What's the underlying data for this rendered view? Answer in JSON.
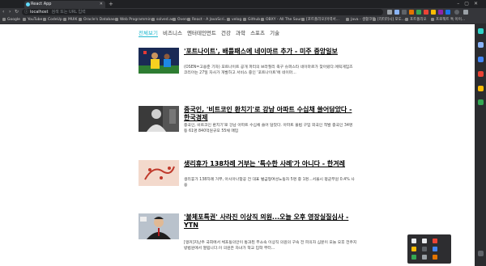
{
  "browser": {
    "tab_title": "React App",
    "url": "localhost",
    "url_hint": "검색 또는 URL 입력",
    "bookmarks": [
      "Google",
      "YouTube",
      "CodeUp",
      "MUIK",
      "Oracle's Database",
      "Web Programming",
      "solved.ac",
      "Oven",
      "React - A JavaScri...",
      "velog",
      "Github",
      "OBXY - All The Sour...",
      "[포트폴리오]이력서...",
      "Java - 생활코딩",
      "[리터러시] 포도...",
      "포트폴리오",
      "프로젝트 톡 이이..."
    ]
  },
  "categories": [
    {
      "label": "전체보기",
      "active": true
    },
    {
      "label": "비즈니스",
      "active": false
    },
    {
      "label": "엔터테인먼트",
      "active": false
    },
    {
      "label": "건강",
      "active": false
    },
    {
      "label": "과학",
      "active": false
    },
    {
      "label": "스포츠",
      "active": false
    },
    {
      "label": "기술",
      "active": false
    }
  ],
  "articles": [
    {
      "title": "'포트나이트', 배틀패스에 네이마르 추가 - 미주 중앙일보",
      "description": "(OSEN=고용준 기자) 포트나이트 공개 파리의 브라질리 축구 슈퍼스타 네이마르가 찾아왔다.에픽게임즈 코리아는 27일 자사가 개발하고 서비스 중인 '포트나이트'에 네이마..."
    },
    {
      "title": "중국인, '비트코인 환치기'로 강남 아파트 수십채 쓸어담았다 - 한국경제",
      "description": "중국인, 비트코인 환치기'로 강남 아파트 수십채 쓸어 담았다. 아파트 불법 구입 외국인 적발 중국인 34명 등 61명 840억원규모 55채 매입"
    },
    {
      "title": "생리휴가 138차례 거부는 '특수한 사례'가 아니다 - 한겨레",
      "description": "생리휴가 138차례 거부, 아시아나항공 전 대표 벌금형여성노동자 5명 중 1명...서울시 평균무원 0.4% 사용"
    },
    {
      "title": "'불체포특권' 사라진 이상직 의원...오늘 오후 영장실질심사 - YTN",
      "description": "[앵커]지난주 국회에서 체포동의안이 통과된 무소속 이상직 의원의 구속 전 피의자 심문이 오늘 오후 전주지방법원에서 열립니다.이 의원은 자녀가 학교 입학 부터..."
    }
  ],
  "colors": {
    "accent": "#22b8cf",
    "page_bg": "#ffffff",
    "browser_bg": "#202124"
  }
}
